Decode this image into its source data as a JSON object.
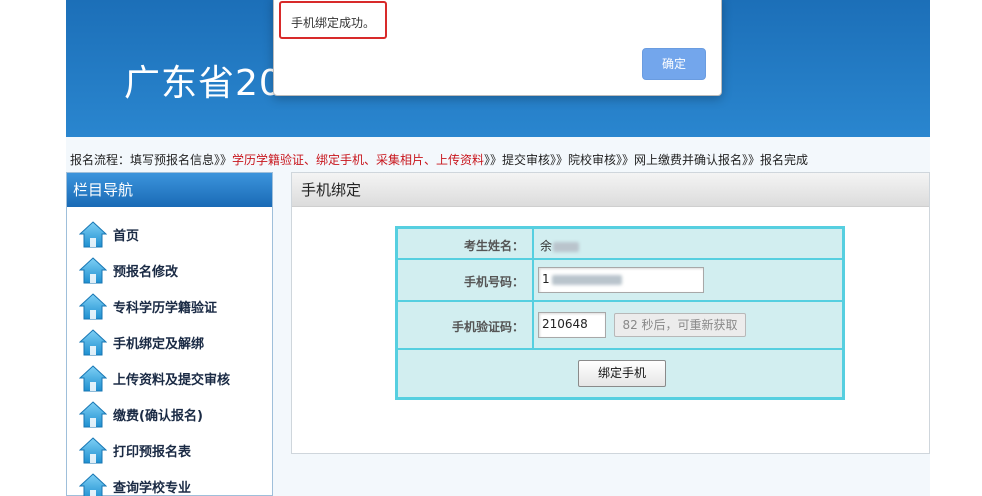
{
  "banner": {
    "title": "广东省20"
  },
  "flow": {
    "prefix": "报名流程：填写预报名信息》》",
    "highlight": "学历学籍验证、绑定手机、采集相片、上传资料",
    "suffix": "》》提交审核》》院校审核》》网上缴费并确认报名》》报名完成"
  },
  "sidebar": {
    "title": "栏目导航",
    "items": [
      {
        "label": "首页",
        "icon": "home-icon"
      },
      {
        "label": "预报名修改",
        "icon": "home-icon"
      },
      {
        "label": "专科学历学籍验证",
        "icon": "home-icon"
      },
      {
        "label": "手机绑定及解绑",
        "icon": "home-icon"
      },
      {
        "label": "上传资料及提交审核",
        "icon": "home-icon"
      },
      {
        "label": "缴费(确认报名)",
        "icon": "home-icon"
      },
      {
        "label": "打印预报名表",
        "icon": "home-icon"
      },
      {
        "label": "查询学校专业",
        "icon": "home-icon"
      }
    ]
  },
  "panel": {
    "title": "手机绑定",
    "name_label": "考生姓名：",
    "name_value": "余",
    "phone_label": "手机号码：",
    "phone_value": "1",
    "code_label": "手机验证码：",
    "code_value": "210648",
    "resend_label": "82 秒后，可重新获取",
    "bind_button": "绑定手机"
  },
  "modal": {
    "message": "手机绑定成功。",
    "ok_button": "确定"
  },
  "colors": {
    "banner": "#2a86cf",
    "accent_red": "#c8161d",
    "table_border": "#56cfe0",
    "table_fill": "#d2eef0",
    "ok_button": "#73a6ec"
  }
}
